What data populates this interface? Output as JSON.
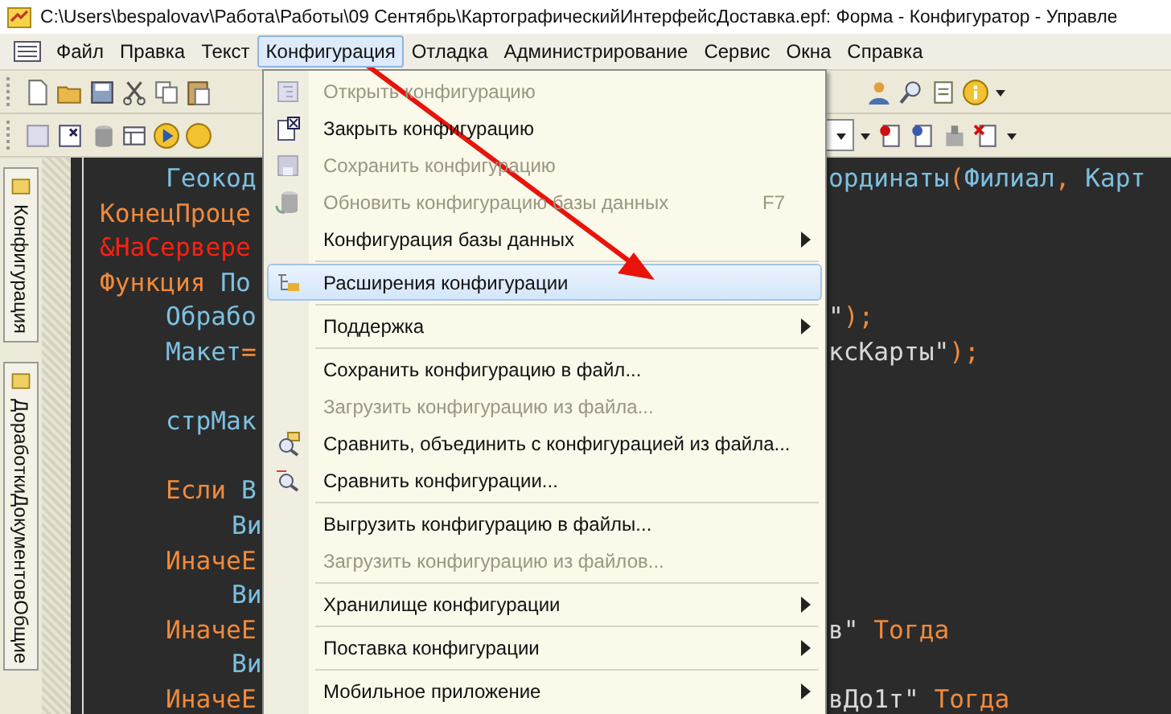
{
  "window": {
    "title": "C:\\Users\\bespalovav\\Работа\\Работы\\09 Сентябрь\\КартографическийИнтерфейсДоставка.epf: Форма - Конфигуратор - Управле"
  },
  "menubar": [
    {
      "label": "Файл",
      "selected": false
    },
    {
      "label": "Правка",
      "selected": false
    },
    {
      "label": "Текст",
      "selected": false
    },
    {
      "label": "Конфигурация",
      "selected": true
    },
    {
      "label": "Отладка",
      "selected": false
    },
    {
      "label": "Администрирование",
      "selected": false
    },
    {
      "label": "Сервис",
      "selected": false
    },
    {
      "label": "Окна",
      "selected": false
    },
    {
      "label": "Справка",
      "selected": false
    }
  ],
  "side_tabs": [
    "Конфигурация",
    "ДоработкиДокументовОбщие"
  ],
  "code_lines": [
    {
      "kind": "code",
      "left": [
        {
          "kind": "id",
          "text": "\tГеокод"
        }
      ],
      "right": [
        {
          "kind": "id",
          "text": "ординаты"
        },
        {
          "kind": "punct",
          "text": "("
        },
        {
          "kind": "id",
          "text": "Филиал"
        },
        {
          "kind": "punct",
          "text": ","
        },
        {
          "kind": "id",
          "text": " Карт"
        }
      ]
    },
    {
      "kind": "code",
      "left": [
        {
          "kind": "kw",
          "text": "КонецПроце"
        }
      ]
    },
    {
      "kind": "code",
      "left": [
        {
          "kind": "dir",
          "text": "&НаСервере"
        }
      ]
    },
    {
      "kind": "code",
      "left": [
        {
          "kind": "kw",
          "text": "Функция"
        },
        {
          "kind": "id",
          "text": " По"
        }
      ]
    },
    {
      "kind": "code",
      "left": [
        {
          "kind": "id",
          "text": "\tОбрабо"
        }
      ],
      "right": [
        {
          "kind": "str",
          "text": "\""
        },
        {
          "kind": "punct",
          "text": ");"
        }
      ]
    },
    {
      "kind": "code",
      "left": [
        {
          "kind": "id",
          "text": "\tМакет"
        },
        {
          "kind": "punct",
          "text": "="
        }
      ],
      "right": [
        {
          "kind": "str",
          "text": "ксКарты\""
        },
        {
          "kind": "punct",
          "text": ");"
        }
      ]
    },
    {
      "kind": "blank"
    },
    {
      "kind": "code",
      "left": [
        {
          "kind": "id",
          "text": "\tстрМак"
        }
      ]
    },
    {
      "kind": "blank"
    },
    {
      "kind": "code",
      "left": [
        {
          "kind": "kw",
          "text": "\tЕсли"
        },
        {
          "kind": "id",
          "text": " В"
        }
      ]
    },
    {
      "kind": "code",
      "left": [
        {
          "kind": "id",
          "text": "\t\tВи"
        }
      ]
    },
    {
      "kind": "code",
      "left": [
        {
          "kind": "kw",
          "text": "\tИначеЕ"
        }
      ]
    },
    {
      "kind": "code",
      "left": [
        {
          "kind": "id",
          "text": "\t\tВи"
        }
      ]
    },
    {
      "kind": "code",
      "left": [
        {
          "kind": "kw",
          "text": "\tИначеЕ"
        }
      ],
      "right": [
        {
          "kind": "str",
          "text": "в\""
        },
        {
          "kind": "kw",
          "text": " Тогда"
        }
      ]
    },
    {
      "kind": "code",
      "left": [
        {
          "kind": "id",
          "text": "\t\tВи"
        }
      ]
    },
    {
      "kind": "code",
      "left": [
        {
          "kind": "kw",
          "text": "\tИначеЕ"
        }
      ],
      "right": [
        {
          "kind": "str",
          "text": "вДо1т\""
        },
        {
          "kind": "kw",
          "text": " Тогда"
        }
      ]
    }
  ],
  "menu": [
    {
      "kind": "item",
      "label": "Открыть конфигурацию",
      "disabled": true,
      "selected": false,
      "submenu": false
    },
    {
      "kind": "item",
      "label": "Закрыть конфигурацию",
      "disabled": false,
      "selected": false,
      "submenu": false
    },
    {
      "kind": "item",
      "label": "Сохранить конфигурацию",
      "disabled": true,
      "selected": false,
      "submenu": false
    },
    {
      "kind": "item",
      "label": "Обновить конфигурацию базы данных",
      "shortcut": "F7",
      "disabled": true,
      "selected": false,
      "submenu": false
    },
    {
      "kind": "item",
      "label": "Конфигурация базы данных",
      "disabled": false,
      "selected": false,
      "submenu": true
    },
    {
      "kind": "separator"
    },
    {
      "kind": "item",
      "label": "Расширения конфигурации",
      "disabled": false,
      "selected": true,
      "submenu": false
    },
    {
      "kind": "separator"
    },
    {
      "kind": "item",
      "label": "Поддержка",
      "disabled": false,
      "selected": false,
      "submenu": true
    },
    {
      "kind": "separator"
    },
    {
      "kind": "item",
      "label": "Сохранить конфигурацию в файл...",
      "disabled": false,
      "selected": false,
      "submenu": false
    },
    {
      "kind": "item",
      "label": "Загрузить конфигурацию из файла...",
      "disabled": true,
      "selected": false,
      "submenu": false
    },
    {
      "kind": "item",
      "label": "Сравнить, объединить с конфигурацией из файла...",
      "disabled": false,
      "selected": false,
      "submenu": false
    },
    {
      "kind": "item",
      "label": "Сравнить конфигурации...",
      "disabled": false,
      "selected": false,
      "submenu": false
    },
    {
      "kind": "separator"
    },
    {
      "kind": "item",
      "label": "Выгрузить конфигурацию в файлы...",
      "disabled": false,
      "selected": false,
      "submenu": false
    },
    {
      "kind": "item",
      "label": "Загрузить конфигурацию из файлов...",
      "disabled": true,
      "selected": false,
      "submenu": false
    },
    {
      "kind": "separator"
    },
    {
      "kind": "item",
      "label": "Хранилище конфигурации",
      "disabled": false,
      "selected": false,
      "submenu": true
    },
    {
      "kind": "separator"
    },
    {
      "kind": "item",
      "label": "Поставка конфигурации",
      "disabled": false,
      "selected": false,
      "submenu": true
    },
    {
      "kind": "separator"
    },
    {
      "kind": "item",
      "label": "Мобильное приложение",
      "disabled": false,
      "selected": false,
      "submenu": true
    }
  ]
}
